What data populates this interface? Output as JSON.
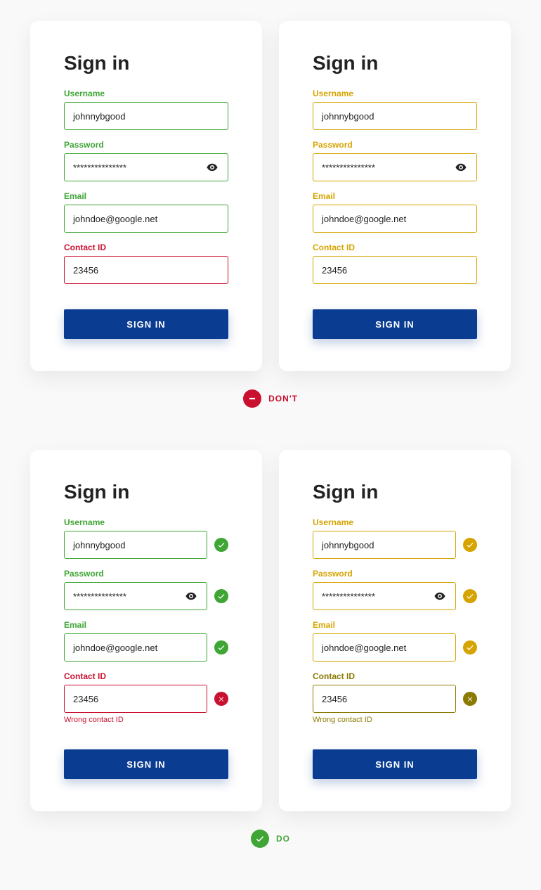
{
  "colors": {
    "green": "#3fa535",
    "red": "#c9102f",
    "gold": "#d6a400",
    "olive": "#8a7a00",
    "primary_button": "#0a3d91"
  },
  "verdicts": {
    "dont": "DON'T",
    "do": "DO"
  },
  "cards": {
    "dont_left": {
      "title": "Sign in",
      "fields": {
        "username": {
          "label": "Username",
          "value": "johnnybgood"
        },
        "password": {
          "label": "Password",
          "value": "***************"
        },
        "email": {
          "label": "Email",
          "value": "johndoe@google.net"
        },
        "contact": {
          "label": "Contact ID",
          "value": "23456"
        }
      },
      "button": "SIGN IN"
    },
    "dont_right": {
      "title": "Sign in",
      "fields": {
        "username": {
          "label": "Username",
          "value": "johnnybgood"
        },
        "password": {
          "label": "Password",
          "value": "***************"
        },
        "email": {
          "label": "Email",
          "value": "johndoe@google.net"
        },
        "contact": {
          "label": "Contact ID",
          "value": "23456"
        }
      },
      "button": "SIGN IN"
    },
    "do_left": {
      "title": "Sign in",
      "fields": {
        "username": {
          "label": "Username",
          "value": "johnnybgood"
        },
        "password": {
          "label": "Password",
          "value": "***************"
        },
        "email": {
          "label": "Email",
          "value": "johndoe@google.net"
        },
        "contact": {
          "label": "Contact ID",
          "value": "23456",
          "helper": "Wrong contact ID"
        }
      },
      "button": "SIGN IN"
    },
    "do_right": {
      "title": "Sign in",
      "fields": {
        "username": {
          "label": "Username",
          "value": "johnnybgood"
        },
        "password": {
          "label": "Password",
          "value": "***************"
        },
        "email": {
          "label": "Email",
          "value": "johndoe@google.net"
        },
        "contact": {
          "label": "Contact ID",
          "value": "23456",
          "helper": "Wrong contact ID"
        }
      },
      "button": "SIGN IN"
    }
  }
}
